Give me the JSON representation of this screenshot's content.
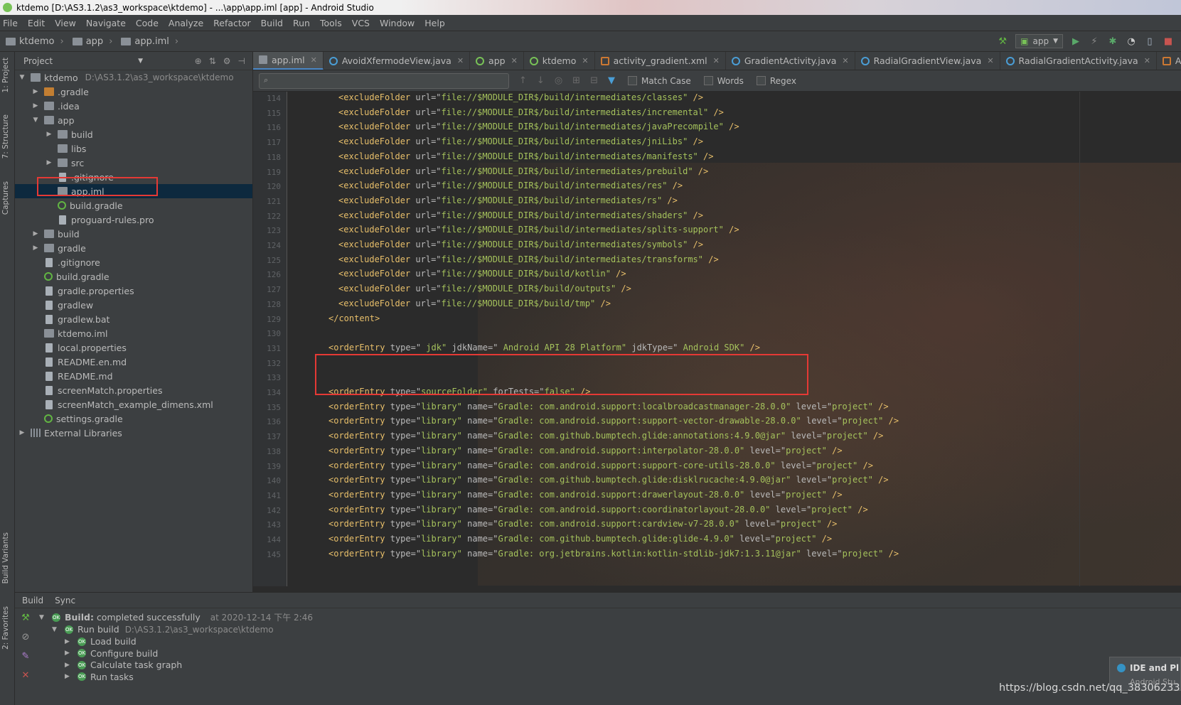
{
  "window_title": "ktdemo [D:\\AS3.1.2\\as3_workspace\\ktdemo] - ...\\app\\app.iml [app] - Android Studio",
  "menu": [
    "File",
    "Edit",
    "View",
    "Navigate",
    "Code",
    "Analyze",
    "Refactor",
    "Build",
    "Run",
    "Tools",
    "VCS",
    "Window",
    "Help"
  ],
  "breadcrumb": [
    "ktdemo",
    "app",
    "app.iml"
  ],
  "run_config": "app",
  "left_strip_tabs": [
    "1: Project",
    "7: Structure",
    "Captures",
    "Build Variants",
    "2: Favorites"
  ],
  "project_panel": {
    "title": "Project",
    "tree": [
      {
        "label": "ktdemo",
        "path": "D:\\AS3.1.2\\as3_workspace\\ktdemo",
        "depth": 0,
        "arrow": "open",
        "icon": "folder"
      },
      {
        "label": ".gradle",
        "depth": 1,
        "arrow": "closed",
        "icon": "folder-orange"
      },
      {
        "label": ".idea",
        "depth": 1,
        "arrow": "closed",
        "icon": "folder"
      },
      {
        "label": "app",
        "depth": 1,
        "arrow": "open",
        "icon": "folder"
      },
      {
        "label": "build",
        "depth": 2,
        "arrow": "closed",
        "icon": "folder"
      },
      {
        "label": "libs",
        "depth": 2,
        "arrow": "none",
        "icon": "folder"
      },
      {
        "label": "src",
        "depth": 2,
        "arrow": "closed",
        "icon": "folder"
      },
      {
        "label": ".gitignore",
        "depth": 2,
        "arrow": "none",
        "icon": "file"
      },
      {
        "label": "app.iml",
        "depth": 2,
        "arrow": "none",
        "icon": "folder",
        "selected": true
      },
      {
        "label": "build.gradle",
        "depth": 2,
        "arrow": "none",
        "icon": "gradle"
      },
      {
        "label": "proguard-rules.pro",
        "depth": 2,
        "arrow": "none",
        "icon": "file"
      },
      {
        "label": "build",
        "depth": 1,
        "arrow": "closed",
        "icon": "folder"
      },
      {
        "label": "gradle",
        "depth": 1,
        "arrow": "closed",
        "icon": "folder"
      },
      {
        "label": ".gitignore",
        "depth": 1,
        "arrow": "none",
        "icon": "file"
      },
      {
        "label": "build.gradle",
        "depth": 1,
        "arrow": "none",
        "icon": "gradle"
      },
      {
        "label": "gradle.properties",
        "depth": 1,
        "arrow": "none",
        "icon": "file"
      },
      {
        "label": "gradlew",
        "depth": 1,
        "arrow": "none",
        "icon": "file"
      },
      {
        "label": "gradlew.bat",
        "depth": 1,
        "arrow": "none",
        "icon": "file"
      },
      {
        "label": "ktdemo.iml",
        "depth": 1,
        "arrow": "none",
        "icon": "folder"
      },
      {
        "label": "local.properties",
        "depth": 1,
        "arrow": "none",
        "icon": "file"
      },
      {
        "label": "README.en.md",
        "depth": 1,
        "arrow": "none",
        "icon": "file"
      },
      {
        "label": "README.md",
        "depth": 1,
        "arrow": "none",
        "icon": "file"
      },
      {
        "label": "screenMatch.properties",
        "depth": 1,
        "arrow": "none",
        "icon": "file"
      },
      {
        "label": "screenMatch_example_dimens.xml",
        "depth": 1,
        "arrow": "none",
        "icon": "file"
      },
      {
        "label": "settings.gradle",
        "depth": 1,
        "arrow": "none",
        "icon": "gradle"
      },
      {
        "label": "External Libraries",
        "depth": 0,
        "arrow": "closed",
        "icon": "lib"
      }
    ]
  },
  "tabs": [
    {
      "label": "app.iml",
      "icon": "iml",
      "active": true
    },
    {
      "label": "AvoidXfermodeView.java",
      "icon": "class"
    },
    {
      "label": "app",
      "icon": "android"
    },
    {
      "label": "ktdemo",
      "icon": "android"
    },
    {
      "label": "activity_gradient.xml",
      "icon": "xml"
    },
    {
      "label": "GradientActivity.java",
      "icon": "class"
    },
    {
      "label": "RadialGradientView.java",
      "icon": "class"
    },
    {
      "label": "RadialGradientActivity.java",
      "icon": "class"
    },
    {
      "label": "AndroidManifest",
      "icon": "xml"
    }
  ],
  "find_bar": {
    "search_value": "",
    "match_case": "Match Case",
    "words": "Words",
    "regex": "Regex"
  },
  "editor": {
    "lines": [
      {
        "num": "114",
        "indent": 1,
        "tag": "excludeFolder",
        "attrs": [
          [
            "url",
            "file://$MODULE_DIR$/build/intermediates/classes"
          ]
        ],
        "end": " />"
      },
      {
        "num": "115",
        "indent": 1,
        "tag": "excludeFolder",
        "attrs": [
          [
            "url",
            "file://$MODULE_DIR$/build/intermediates/incremental"
          ]
        ],
        "end": " />"
      },
      {
        "num": "116",
        "indent": 1,
        "tag": "excludeFolder",
        "attrs": [
          [
            "url",
            "file://$MODULE_DIR$/build/intermediates/javaPrecompile"
          ]
        ],
        "end": " />"
      },
      {
        "num": "117",
        "indent": 1,
        "tag": "excludeFolder",
        "attrs": [
          [
            "url",
            "file://$MODULE_DIR$/build/intermediates/jniLibs"
          ]
        ],
        "end": " />"
      },
      {
        "num": "118",
        "indent": 1,
        "tag": "excludeFolder",
        "attrs": [
          [
            "url",
            "file://$MODULE_DIR$/build/intermediates/manifests"
          ]
        ],
        "end": " />"
      },
      {
        "num": "119",
        "indent": 1,
        "tag": "excludeFolder",
        "attrs": [
          [
            "url",
            "file://$MODULE_DIR$/build/intermediates/prebuild"
          ]
        ],
        "end": " />"
      },
      {
        "num": "120",
        "indent": 1,
        "tag": "excludeFolder",
        "attrs": [
          [
            "url",
            "file://$MODULE_DIR$/build/intermediates/res"
          ]
        ],
        "end": " />"
      },
      {
        "num": "121",
        "indent": 1,
        "tag": "excludeFolder",
        "attrs": [
          [
            "url",
            "file://$MODULE_DIR$/build/intermediates/rs"
          ]
        ],
        "end": " />"
      },
      {
        "num": "122",
        "indent": 1,
        "tag": "excludeFolder",
        "attrs": [
          [
            "url",
            "file://$MODULE_DIR$/build/intermediates/shaders"
          ]
        ],
        "end": " />"
      },
      {
        "num": "123",
        "indent": 1,
        "tag": "excludeFolder",
        "attrs": [
          [
            "url",
            "file://$MODULE_DIR$/build/intermediates/splits-support"
          ]
        ],
        "end": " />"
      },
      {
        "num": "124",
        "indent": 1,
        "tag": "excludeFolder",
        "attrs": [
          [
            "url",
            "file://$MODULE_DIR$/build/intermediates/symbols"
          ]
        ],
        "end": " />"
      },
      {
        "num": "125",
        "indent": 1,
        "tag": "excludeFolder",
        "attrs": [
          [
            "url",
            "file://$MODULE_DIR$/build/intermediates/transforms"
          ]
        ],
        "end": " />"
      },
      {
        "num": "126",
        "indent": 1,
        "tag": "excludeFolder",
        "attrs": [
          [
            "url",
            "file://$MODULE_DIR$/build/kotlin"
          ]
        ],
        "end": " />"
      },
      {
        "num": "127",
        "indent": 1,
        "tag": "excludeFolder",
        "attrs": [
          [
            "url",
            "file://$MODULE_DIR$/build/outputs"
          ]
        ],
        "end": " />"
      },
      {
        "num": "128",
        "indent": 1,
        "tag": "excludeFolder",
        "attrs": [
          [
            "url",
            "file://$MODULE_DIR$/build/tmp"
          ]
        ],
        "end": " />"
      },
      {
        "num": "129",
        "indent": 0,
        "raw": "</content>"
      },
      {
        "num": "130",
        "indent": 0,
        "raw": ""
      },
      {
        "num": "131",
        "indent": 0,
        "tag": "orderEntry",
        "attrs": [
          [
            "type",
            " jdk"
          ],
          [
            "jdkName",
            " Android API 28 Platform"
          ],
          [
            "jdkType",
            " Android SDK"
          ]
        ],
        "end": " />"
      },
      {
        "num": "132",
        "indent": 0,
        "raw": ""
      },
      {
        "num": "133",
        "indent": 0,
        "raw": ""
      },
      {
        "num": "134",
        "indent": 0,
        "tag": "orderEntry",
        "attrs": [
          [
            "type",
            "sourceFolder"
          ],
          [
            "forTests",
            "false"
          ]
        ],
        "end": " />"
      },
      {
        "num": "135",
        "indent": 0,
        "tag": "orderEntry",
        "attrs": [
          [
            "type",
            "library"
          ],
          [
            "name",
            "Gradle: com.android.support:localbroadcastmanager-28.0.0"
          ],
          [
            "level",
            "project"
          ]
        ],
        "end": " />"
      },
      {
        "num": "136",
        "indent": 0,
        "tag": "orderEntry",
        "attrs": [
          [
            "type",
            "library"
          ],
          [
            "name",
            "Gradle: com.android.support:support-vector-drawable-28.0.0"
          ],
          [
            "level",
            "project"
          ]
        ],
        "end": " />"
      },
      {
        "num": "137",
        "indent": 0,
        "tag": "orderEntry",
        "attrs": [
          [
            "type",
            "library"
          ],
          [
            "name",
            "Gradle: com.github.bumptech.glide:annotations:4.9.0@jar"
          ],
          [
            "level",
            "project"
          ]
        ],
        "end": " />"
      },
      {
        "num": "138",
        "indent": 0,
        "tag": "orderEntry",
        "attrs": [
          [
            "type",
            "library"
          ],
          [
            "name",
            "Gradle: com.android.support:interpolator-28.0.0"
          ],
          [
            "level",
            "project"
          ]
        ],
        "end": " />"
      },
      {
        "num": "139",
        "indent": 0,
        "tag": "orderEntry",
        "attrs": [
          [
            "type",
            "library"
          ],
          [
            "name",
            "Gradle: com.android.support:support-core-utils-28.0.0"
          ],
          [
            "level",
            "project"
          ]
        ],
        "end": " />"
      },
      {
        "num": "140",
        "indent": 0,
        "tag": "orderEntry",
        "attrs": [
          [
            "type",
            "library"
          ],
          [
            "name",
            "Gradle: com.github.bumptech.glide:disklrucache:4.9.0@jar"
          ],
          [
            "level",
            "project"
          ]
        ],
        "end": " />"
      },
      {
        "num": "141",
        "indent": 0,
        "tag": "orderEntry",
        "attrs": [
          [
            "type",
            "library"
          ],
          [
            "name",
            "Gradle: com.android.support:drawerlayout-28.0.0"
          ],
          [
            "level",
            "project"
          ]
        ],
        "end": " />"
      },
      {
        "num": "142",
        "indent": 0,
        "tag": "orderEntry",
        "attrs": [
          [
            "type",
            "library"
          ],
          [
            "name",
            "Gradle: com.android.support:coordinatorlayout-28.0.0"
          ],
          [
            "level",
            "project"
          ]
        ],
        "end": " />"
      },
      {
        "num": "143",
        "indent": 0,
        "tag": "orderEntry",
        "attrs": [
          [
            "type",
            "library"
          ],
          [
            "name",
            "Gradle: com.android.support:cardview-v7-28.0.0"
          ],
          [
            "level",
            "project"
          ]
        ],
        "end": " />"
      },
      {
        "num": "144",
        "indent": 0,
        "tag": "orderEntry",
        "attrs": [
          [
            "type",
            "library"
          ],
          [
            "name",
            "Gradle: com.github.bumptech.glide:glide-4.9.0"
          ],
          [
            "level",
            "project"
          ]
        ],
        "end": " />"
      },
      {
        "num": "145",
        "indent": 0,
        "tag": "orderEntry",
        "attrs": [
          [
            "type",
            "library"
          ],
          [
            "name",
            "Gradle: org.jetbrains.kotlin:kotlin-stdlib-jdk7:1.3.11@jar"
          ],
          [
            "level",
            "project"
          ]
        ],
        "end": " />"
      }
    ]
  },
  "build_panel": {
    "tabs": [
      "Build",
      "Sync"
    ],
    "status_label": "Build:",
    "status_text": "completed successfully",
    "timestamp": "at 2020-12-14 下午 2:46",
    "run_build": "Run build",
    "run_build_path": "D:\\AS3.1.2\\as3_workspace\\ktdemo",
    "tasks": [
      "Load build",
      "Configure build",
      "Calculate task graph",
      "Run tasks"
    ]
  },
  "notification": {
    "title": "IDE and Pl",
    "subtitle": "Android Stu"
  },
  "watermark": "https://blog.csdn.net/qq_38306233",
  "colors": {
    "accent": "#4a88c7",
    "highlight": "#e53935",
    "success": "#499c54",
    "xml_tag": "#e8bf6a",
    "xml_value": "#a5c25c"
  }
}
